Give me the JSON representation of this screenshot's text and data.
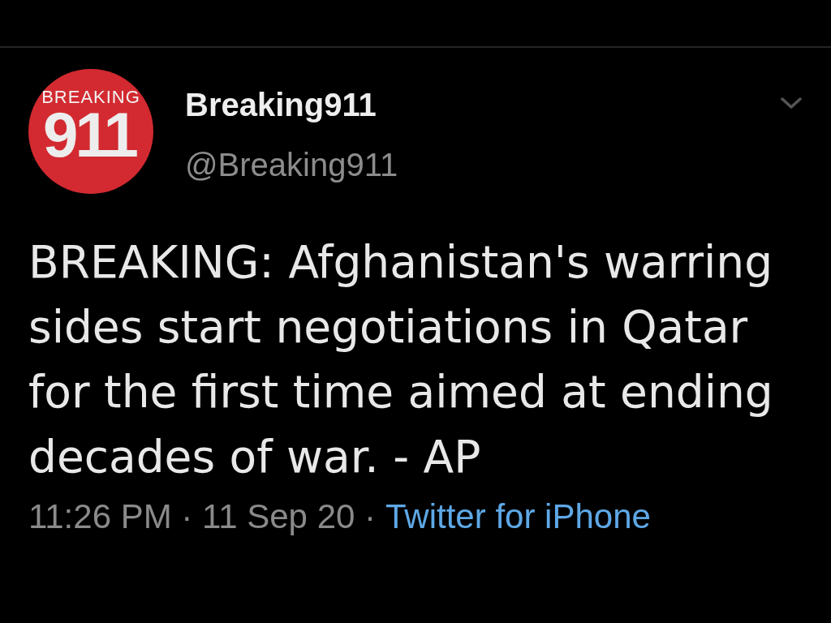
{
  "tweet": {
    "author": {
      "avatar": {
        "logo_caption": "BREAKING",
        "logo_number": "911"
      },
      "name": "Breaking911",
      "handle": "@Breaking911"
    },
    "text": "BREAKING: Afghanistan's warring sides start negotiations in Qatar for the first time aimed at ending decades of war. - AP",
    "timestamp": "11:26 PM · 11 Sep 20 ·",
    "source": "Twitter for iPhone"
  }
}
